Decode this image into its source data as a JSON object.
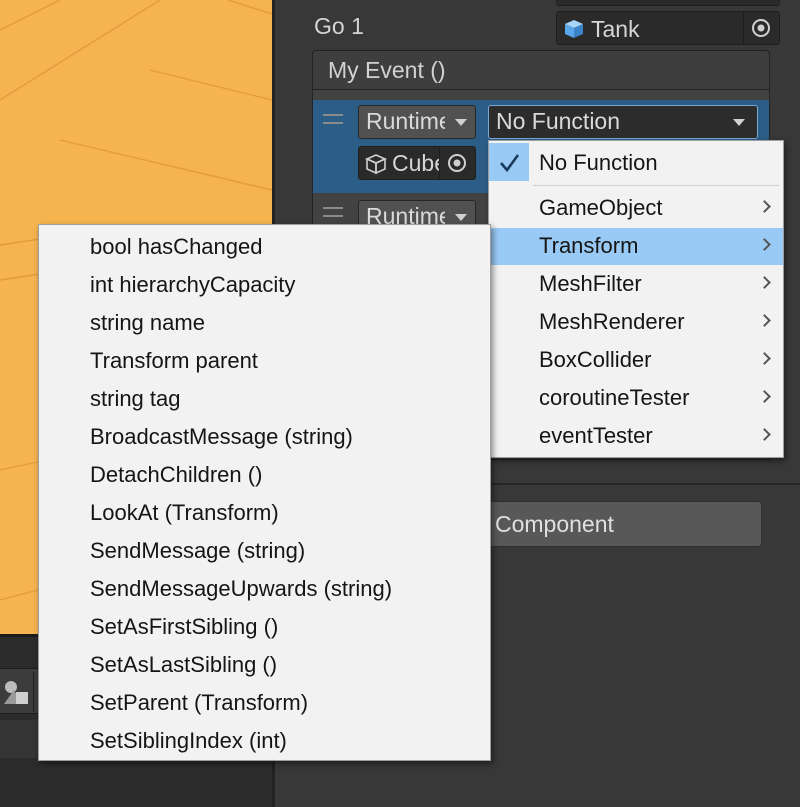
{
  "scene": {
    "grid_color": "#e49a40",
    "background": "#f5b44f"
  },
  "inspector": {
    "go_label": "Go 1",
    "target_object": {
      "name": "Tank",
      "icon": "prefab-cube-icon"
    },
    "event_title": "My Event ()",
    "entries": [
      {
        "mode": "Runtime",
        "mode_display": "Runtime",
        "target": "Cube",
        "function": "No Function"
      },
      {
        "mode": "Runtime",
        "mode_display": "Runtime"
      }
    ],
    "add_component_label": "Component"
  },
  "function_menu": {
    "checked_item": "No Function",
    "items": [
      {
        "label": "GameObject",
        "submenu": true
      },
      {
        "label": "Transform",
        "submenu": true,
        "highlighted": true
      },
      {
        "label": "MeshFilter",
        "submenu": true
      },
      {
        "label": "MeshRenderer",
        "submenu": true
      },
      {
        "label": "BoxCollider",
        "submenu": true
      },
      {
        "label": "coroutineTester",
        "submenu": true
      },
      {
        "label": "eventTester",
        "submenu": true
      }
    ]
  },
  "transform_menu": {
    "items": [
      "bool hasChanged",
      "int hierarchyCapacity",
      "string name",
      "Transform parent",
      "string tag",
      "BroadcastMessage (string)",
      "DetachChildren ()",
      "LookAt (Transform)",
      "SendMessage (string)",
      "SendMessageUpwards (string)",
      "SetAsFirstSibling ()",
      "SetAsLastSibling ()",
      "SetParent (Transform)",
      "SetSiblingIndex (int)"
    ]
  },
  "colors": {
    "highlight": "#99c9f5",
    "selected_entry": "#2c5d87",
    "panel": "#383838"
  }
}
